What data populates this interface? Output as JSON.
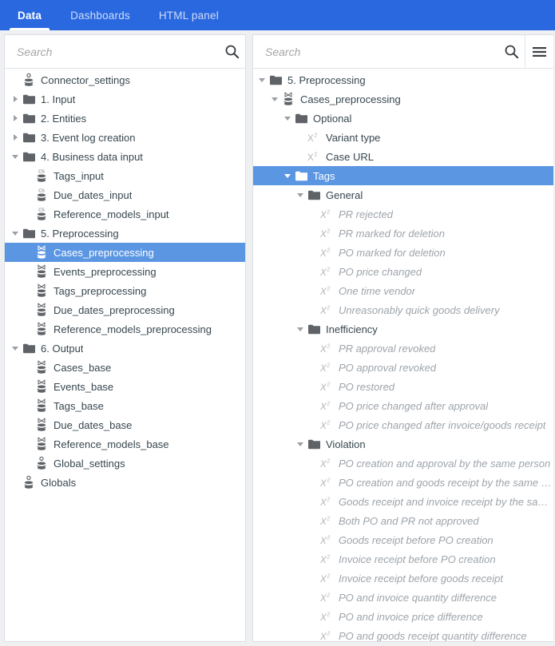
{
  "colors": {
    "tabbar_bg": "#2a68e0",
    "selection_bg": "#5b96e3",
    "panel_bg": "#ffffff",
    "folder_icon": "#5f6368",
    "muted_text": "#9ea4aa",
    "text": "#37474f"
  },
  "tabs": [
    {
      "label": "Data",
      "active": true
    },
    {
      "label": "Dashboards",
      "active": false
    },
    {
      "label": "HTML panel",
      "active": false
    }
  ],
  "left_panel": {
    "search": {
      "placeholder": "Search",
      "value": "",
      "icon": "search-icon"
    },
    "tree": [
      {
        "label": "Connector_settings",
        "depth": 0,
        "icon": "database-icon",
        "caret": "none",
        "state": "normal"
      },
      {
        "label": "1. Input",
        "depth": 0,
        "icon": "folder-icon",
        "caret": "right",
        "state": "normal"
      },
      {
        "label": "2. Entities",
        "depth": 0,
        "icon": "folder-icon",
        "caret": "right",
        "state": "normal"
      },
      {
        "label": "3. Event log creation",
        "depth": 0,
        "icon": "folder-icon",
        "caret": "right",
        "state": "normal"
      },
      {
        "label": "4. Business data input",
        "depth": 0,
        "icon": "folder-icon",
        "caret": "down",
        "state": "normal"
      },
      {
        "label": "Tags_input",
        "depth": 1,
        "icon": "database-cs-icon",
        "caret": "none",
        "state": "normal"
      },
      {
        "label": "Due_dates_input",
        "depth": 1,
        "icon": "database-cs-icon",
        "caret": "none",
        "state": "normal"
      },
      {
        "label": "Reference_models_input",
        "depth": 1,
        "icon": "database-cs-icon",
        "caret": "none",
        "state": "normal"
      },
      {
        "label": "5. Preprocessing",
        "depth": 0,
        "icon": "folder-icon",
        "caret": "down",
        "state": "normal"
      },
      {
        "label": "Cases_preprocessing",
        "depth": 1,
        "icon": "database-join-icon",
        "caret": "none",
        "state": "selected"
      },
      {
        "label": "Events_preprocessing",
        "depth": 1,
        "icon": "database-join-icon",
        "caret": "none",
        "state": "normal"
      },
      {
        "label": "Tags_preprocessing",
        "depth": 1,
        "icon": "database-join-icon",
        "caret": "none",
        "state": "normal"
      },
      {
        "label": "Due_dates_preprocessing",
        "depth": 1,
        "icon": "database-join-icon",
        "caret": "none",
        "state": "normal"
      },
      {
        "label": "Reference_models_preprocessing",
        "depth": 1,
        "icon": "database-join-icon",
        "caret": "none",
        "state": "normal"
      },
      {
        "label": "6. Output",
        "depth": 0,
        "icon": "folder-icon",
        "caret": "down",
        "state": "normal"
      },
      {
        "label": "Cases_base",
        "depth": 1,
        "icon": "database-join-icon",
        "caret": "none",
        "state": "normal"
      },
      {
        "label": "Events_base",
        "depth": 1,
        "icon": "database-join-icon",
        "caret": "none",
        "state": "normal"
      },
      {
        "label": "Tags_base",
        "depth": 1,
        "icon": "database-join-icon",
        "caret": "none",
        "state": "normal"
      },
      {
        "label": "Due_dates_base",
        "depth": 1,
        "icon": "database-join-icon",
        "caret": "none",
        "state": "normal"
      },
      {
        "label": "Reference_models_base",
        "depth": 1,
        "icon": "database-join-icon",
        "caret": "none",
        "state": "normal"
      },
      {
        "label": "Global_settings",
        "depth": 1,
        "icon": "database-icon",
        "caret": "none",
        "state": "normal"
      },
      {
        "label": "Globals",
        "depth": 0,
        "icon": "database-icon",
        "caret": "none",
        "state": "normal"
      }
    ]
  },
  "right_panel": {
    "search": {
      "placeholder": "Search",
      "value": "",
      "icon": "search-icon"
    },
    "menu_icon": "hamburger-menu-icon",
    "tree": [
      {
        "label": "5. Preprocessing",
        "depth": 0,
        "icon": "folder-icon",
        "caret": "down",
        "state": "normal"
      },
      {
        "label": "Cases_preprocessing",
        "depth": 1,
        "icon": "database-join-icon",
        "caret": "down",
        "state": "normal"
      },
      {
        "label": "Optional",
        "depth": 2,
        "icon": "folder-icon",
        "caret": "down",
        "state": "normal"
      },
      {
        "label": "Variant type",
        "depth": 3,
        "icon": "formula-x2-icon",
        "caret": "none",
        "state": "normal"
      },
      {
        "label": "Case URL",
        "depth": 3,
        "icon": "formula-x2-icon",
        "caret": "none",
        "state": "normal"
      },
      {
        "label": "Tags",
        "depth": 2,
        "icon": "folder-icon",
        "caret": "down",
        "state": "selected"
      },
      {
        "label": "General",
        "depth": 3,
        "icon": "folder-icon",
        "caret": "down",
        "state": "normal"
      },
      {
        "label": "PR rejected",
        "depth": 4,
        "icon": "formula-x2-icon",
        "caret": "none",
        "state": "muted"
      },
      {
        "label": "PR marked for deletion",
        "depth": 4,
        "icon": "formula-x2-icon",
        "caret": "none",
        "state": "muted"
      },
      {
        "label": "PO marked for deletion",
        "depth": 4,
        "icon": "formula-x2-icon",
        "caret": "none",
        "state": "muted"
      },
      {
        "label": "PO price changed",
        "depth": 4,
        "icon": "formula-x2-icon",
        "caret": "none",
        "state": "muted"
      },
      {
        "label": "One time vendor",
        "depth": 4,
        "icon": "formula-x2-icon",
        "caret": "none",
        "state": "muted"
      },
      {
        "label": "Unreasonably quick goods delivery",
        "depth": 4,
        "icon": "formula-x2-icon",
        "caret": "none",
        "state": "muted"
      },
      {
        "label": "Inefficiency",
        "depth": 3,
        "icon": "folder-icon",
        "caret": "down",
        "state": "normal"
      },
      {
        "label": "PR approval revoked",
        "depth": 4,
        "icon": "formula-x2-icon",
        "caret": "none",
        "state": "muted"
      },
      {
        "label": "PO approval revoked",
        "depth": 4,
        "icon": "formula-x2-icon",
        "caret": "none",
        "state": "muted"
      },
      {
        "label": "PO restored",
        "depth": 4,
        "icon": "formula-x2-icon",
        "caret": "none",
        "state": "muted"
      },
      {
        "label": "PO price changed after approval",
        "depth": 4,
        "icon": "formula-x2-icon",
        "caret": "none",
        "state": "muted"
      },
      {
        "label": "PO price changed after invoice/goods receipt",
        "depth": 4,
        "icon": "formula-x2-icon",
        "caret": "none",
        "state": "muted"
      },
      {
        "label": "Violation",
        "depth": 3,
        "icon": "folder-icon",
        "caret": "down",
        "state": "normal"
      },
      {
        "label": "PO creation and approval by the same person",
        "depth": 4,
        "icon": "formula-x2-icon",
        "caret": "none",
        "state": "muted"
      },
      {
        "label": "PO creation and goods receipt by the same person",
        "depth": 4,
        "icon": "formula-x2-icon",
        "caret": "none",
        "state": "muted"
      },
      {
        "label": "Goods receipt and invoice receipt by the same person",
        "depth": 4,
        "icon": "formula-x2-icon",
        "caret": "none",
        "state": "muted"
      },
      {
        "label": "Both PO and PR not approved",
        "depth": 4,
        "icon": "formula-x2-icon",
        "caret": "none",
        "state": "muted"
      },
      {
        "label": "Goods receipt before PO creation",
        "depth": 4,
        "icon": "formula-x2-icon",
        "caret": "none",
        "state": "muted"
      },
      {
        "label": "Invoice receipt before PO creation",
        "depth": 4,
        "icon": "formula-x2-icon",
        "caret": "none",
        "state": "muted"
      },
      {
        "label": "Invoice receipt before goods receipt",
        "depth": 4,
        "icon": "formula-x2-icon",
        "caret": "none",
        "state": "muted"
      },
      {
        "label": "PO and invoice quantity difference",
        "depth": 4,
        "icon": "formula-x2-icon",
        "caret": "none",
        "state": "muted"
      },
      {
        "label": "PO and invoice price difference",
        "depth": 4,
        "icon": "formula-x2-icon",
        "caret": "none",
        "state": "muted"
      },
      {
        "label": "PO and goods receipt quantity difference",
        "depth": 4,
        "icon": "formula-x2-icon",
        "caret": "none",
        "state": "muted"
      }
    ]
  }
}
